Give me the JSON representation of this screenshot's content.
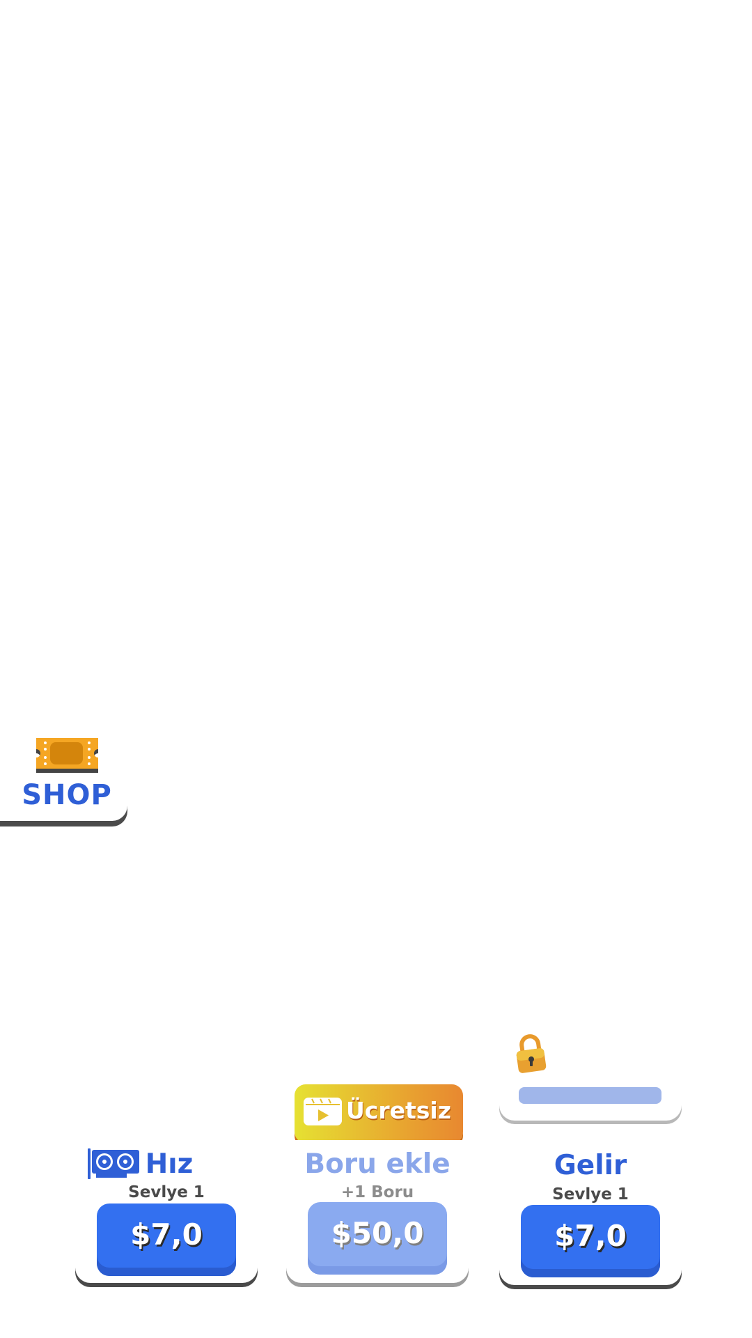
{
  "shop": {
    "label": "SHOP",
    "icon": "ticket-icon"
  },
  "cards": [
    {
      "title": "Hız",
      "subtitle": "Sevlye 1",
      "price": "$7,0",
      "icon": "gpu-icon"
    },
    {
      "title": "Boru ekle",
      "subtitle": "+1 Boru",
      "price": "$50,0",
      "disabled": true
    },
    {
      "title": "Gelir",
      "subtitle": "Sevlye 1",
      "price": "$7,0"
    }
  ],
  "free_button": {
    "label": "Ücretsiz",
    "icon": "video-play-icon"
  },
  "locked_item": {
    "icon": "lock-icon"
  },
  "colors": {
    "primary_blue": "#3370f0",
    "title_blue": "#2f5fd6",
    "disabled_blue": "#8aaaf0",
    "free_gradient_start": "#e6e132",
    "free_gradient_end": "#e88830",
    "ticket_orange": "#f5a623"
  }
}
